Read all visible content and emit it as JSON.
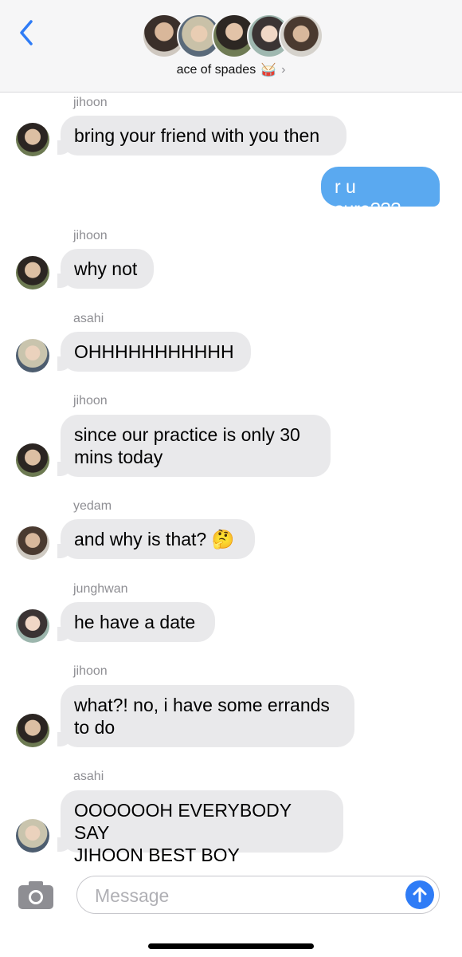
{
  "header": {
    "group_name": "ace of spades",
    "group_emoji": "🥁",
    "chevron": "›"
  },
  "messages": [
    {
      "sender": "jihoon",
      "lines": [
        "bring your friend with you then"
      ],
      "direction": "in"
    },
    {
      "sender": "",
      "lines": [
        "r u sure???"
      ],
      "direction": "out"
    },
    {
      "sender": "jihoon",
      "lines": [
        "why not"
      ],
      "direction": "in"
    },
    {
      "sender": "asahi",
      "lines": [
        "OHHHHHHHHHHH"
      ],
      "direction": "in"
    },
    {
      "sender": "jihoon",
      "lines": [
        "since our practice is only 30",
        "mins today"
      ],
      "direction": "in"
    },
    {
      "sender": "yedam",
      "lines": [
        "and why is that? 🤔"
      ],
      "direction": "in"
    },
    {
      "sender": "junghwan",
      "lines": [
        "he have a date"
      ],
      "direction": "in"
    },
    {
      "sender": "jihoon",
      "lines": [
        "what?! no, i have some errands",
        "to do"
      ],
      "direction": "in"
    },
    {
      "sender": "asahi",
      "lines": [
        "OOOOOOH EVERYBODY SAY",
        "JIHOON BEST BOY"
      ],
      "direction": "in"
    }
  ],
  "input": {
    "placeholder": "Message"
  },
  "colors": {
    "incoming_bubble": "#e9e9eb",
    "outgoing_bubble": "#5aa9f0",
    "send_button": "#2f7cf6",
    "back_chevron": "#2f7cf6"
  }
}
